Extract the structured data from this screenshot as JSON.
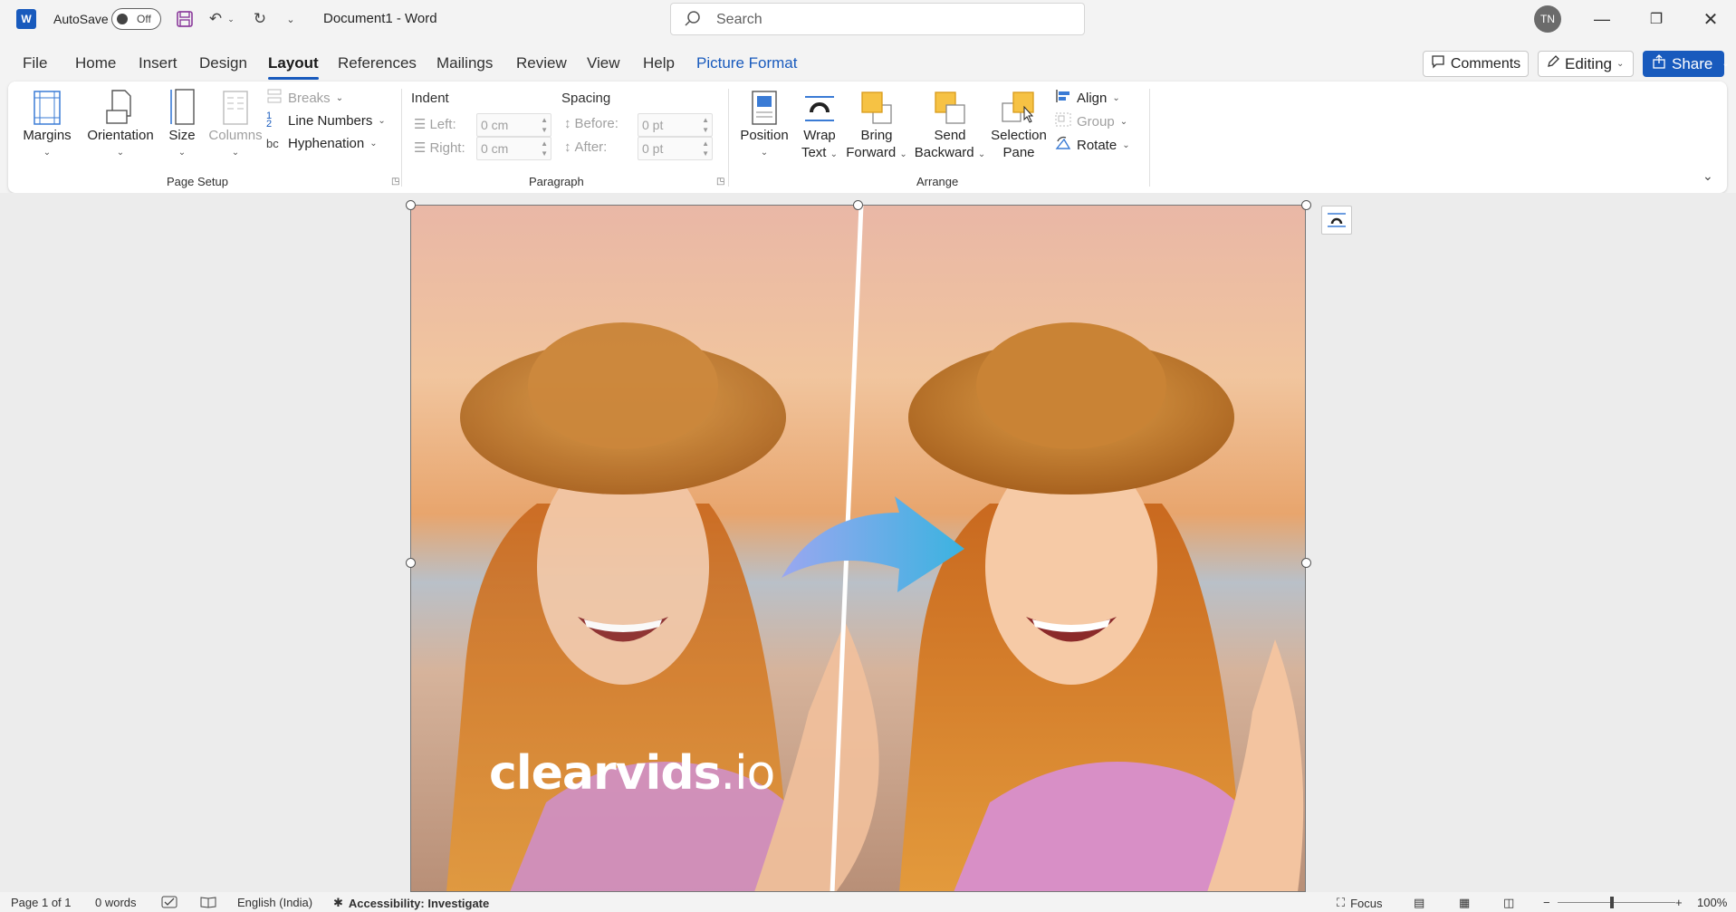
{
  "titlebar": {
    "app_icon": "word-logo-icon",
    "autosave_label": "AutoSave",
    "autosave_state": "Off",
    "document_title": "Document1  -  Word",
    "search_placeholder": "Search",
    "avatar_initials": "TN"
  },
  "tabs": [
    "File",
    "Home",
    "Insert",
    "Design",
    "Layout",
    "References",
    "Mailings",
    "Review",
    "View",
    "Help",
    "Picture Format"
  ],
  "active_tab": "Layout",
  "actions": {
    "comments": "Comments",
    "editing": "Editing",
    "share": "Share"
  },
  "ribbon": {
    "page_setup": {
      "label": "Page Setup",
      "margins": "Margins",
      "orientation": "Orientation",
      "size": "Size",
      "columns": "Columns",
      "breaks": "Breaks",
      "line_numbers": "Line Numbers",
      "hyphenation": "Hyphenation"
    },
    "paragraph": {
      "label": "Paragraph",
      "indent": "Indent",
      "spacing": "Spacing",
      "left_label": "Left:",
      "left_value": "0 cm",
      "right_label": "Right:",
      "right_value": "0 cm",
      "before_label": "Before:",
      "before_value": "0 pt",
      "after_label": "After:",
      "after_value": "0 pt"
    },
    "arrange": {
      "label": "Arrange",
      "position": "Position",
      "wrap_text_1": "Wrap",
      "wrap_text_2": "Text",
      "bring_forward_1": "Bring",
      "bring_forward_2": "Forward",
      "send_backward_1": "Send",
      "send_backward_2": "Backward",
      "selection_pane_1": "Selection",
      "selection_pane_2": "Pane",
      "align": "Align",
      "group": "Group",
      "rotate": "Rotate"
    }
  },
  "document": {
    "watermark_brand": "clearvids",
    "watermark_tld": ".io"
  },
  "statusbar": {
    "page": "Page 1 of 1",
    "words": "0 words",
    "language": "English (India)",
    "accessibility": "Accessibility: Investigate",
    "focus": "Focus",
    "zoom_minus": "−",
    "zoom_plus": "+",
    "zoom": "100%"
  },
  "colors": {
    "accent": "#185abd",
    "ribbon_bg": "#ffffff",
    "window_bg": "#f3f3f3",
    "canvas_bg": "#ececec"
  }
}
